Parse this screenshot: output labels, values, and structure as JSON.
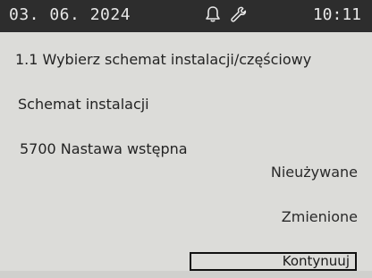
{
  "status_bar": {
    "date": "03. 06. 2024",
    "time": "10:11",
    "icons": [
      "bell-icon",
      "wrench-icon"
    ]
  },
  "menu": {
    "title": "1.1 Wybierz schemat instalacji/częściowy"
  },
  "rows": {
    "schema_label": "Schemat instalacji",
    "param_label": "5700 Nastawa wstępna",
    "param_value_unused": "Nieużywane",
    "param_value_changed": "Zmienione"
  },
  "actions": {
    "continue_label": "Kontynuuj"
  },
  "colors": {
    "status_bar_bg": "#2d2d2d",
    "screen_bg": "#dcdcd9",
    "text": "#232323"
  }
}
